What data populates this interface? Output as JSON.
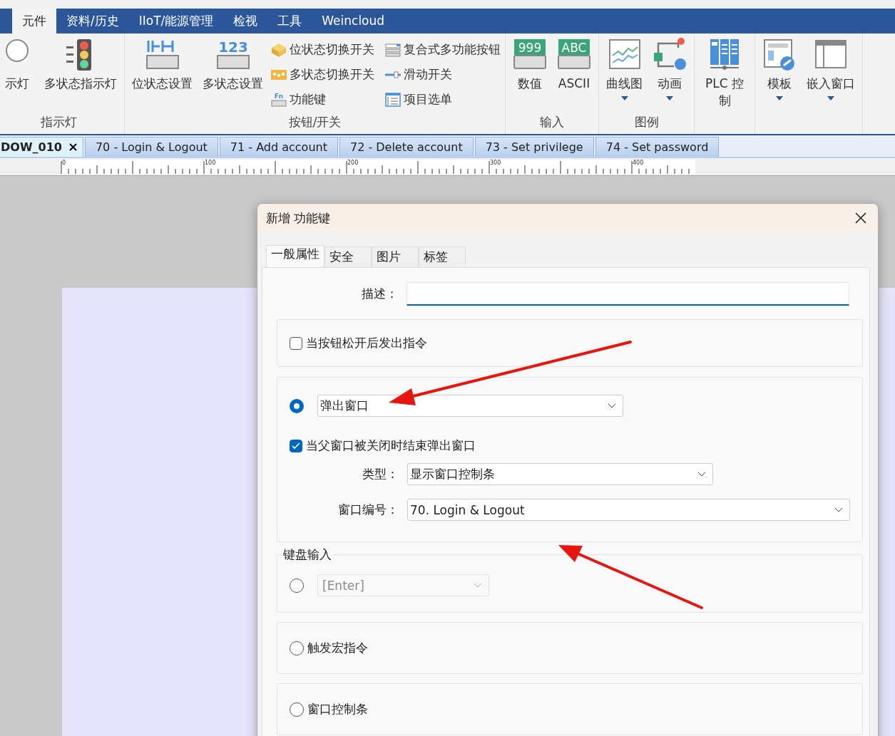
{
  "menu": [
    {
      "label": "元件",
      "selected": true
    },
    {
      "label": "资料/历史",
      "selected": false
    },
    {
      "label": "IIoT/能源管理",
      "selected": false
    },
    {
      "label": "检视",
      "selected": false
    },
    {
      "label": "工具",
      "selected": false
    },
    {
      "label": "Weincloud",
      "selected": false
    }
  ],
  "ribbon": [
    {
      "label": "指示灯",
      "large": [
        {
          "label": "示灯",
          "kind": "lamp"
        },
        {
          "label": "多状态指示灯",
          "kind": "traffic"
        }
      ]
    },
    {
      "label": "按钮/开关",
      "large": [
        {
          "label": "位状态设置",
          "kind": "bitset"
        },
        {
          "label": "多状态设置",
          "kind": "multiset",
          "icon_text": "123"
        }
      ],
      "small": [
        {
          "label": "位状态切换开关",
          "kind": "bittoggle"
        },
        {
          "label": "多状态切换开关",
          "kind": "multitoggle"
        },
        {
          "label": "功能键",
          "kind": "fn",
          "icon_text": "Fn"
        },
        {
          "label": "复合式多功能按钮",
          "kind": "combo"
        },
        {
          "label": "滑动开关",
          "kind": "slider"
        },
        {
          "label": "项目选单",
          "kind": "option"
        }
      ]
    },
    {
      "label": "输入",
      "large": [
        {
          "label": "数值",
          "kind": "numeric",
          "icon_text": "999"
        },
        {
          "label": "ASCII",
          "kind": "ascii",
          "icon_text": "ABC"
        }
      ]
    },
    {
      "label": "图例",
      "large": [
        {
          "label": "曲线图",
          "kind": "trend",
          "dropdown": true
        },
        {
          "label": "动画",
          "kind": "animation",
          "dropdown": true
        }
      ]
    },
    {
      "large": [
        {
          "label": "PLC 控制",
          "kind": "plc"
        }
      ]
    },
    {
      "large": [
        {
          "label": "模板",
          "kind": "template",
          "dropdown": true
        },
        {
          "label": "嵌入窗口",
          "kind": "embed",
          "dropdown": true
        }
      ]
    }
  ],
  "document_tabs": [
    {
      "label": "DOW_010",
      "selected": true
    },
    {
      "label": "70 - Login & Logout",
      "selected": false
    },
    {
      "label": "71 - Add account",
      "selected": false
    },
    {
      "label": "72 - Delete account",
      "selected": false
    },
    {
      "label": "73 - Set privilege",
      "selected": false
    },
    {
      "label": "74 - Set password",
      "selected": false
    }
  ],
  "ruler": [
    "0",
    "100",
    "200",
    "300",
    "400"
  ],
  "dialog": {
    "title": "新增 功能键",
    "tabs": [
      {
        "label": "一般属性",
        "selected": true
      },
      {
        "label": "安全",
        "selected": false
      },
      {
        "label": "图片",
        "selected": false
      },
      {
        "label": "标签",
        "selected": false
      }
    ],
    "description_label": "描述：",
    "release_option": {
      "label": "当按钮松开后发出指令",
      "checked": false
    },
    "modes": [
      {
        "kind": "popup",
        "selected": true,
        "value": "弹出窗口",
        "close_with_parent": {
          "label": "当父窗口被关闭时结束弹出窗口",
          "checked": true
        },
        "fields": [
          {
            "label": "类型：",
            "value": "显示窗口控制条"
          },
          {
            "label": "窗口编号：",
            "value": "70. Login & Logout"
          }
        ]
      },
      {
        "kind": "keyboard",
        "legend": "键盘输入",
        "selected": false,
        "value": "[Enter]",
        "disabled": true
      },
      {
        "kind": "plain",
        "selected": false,
        "label": "触发宏指令"
      },
      {
        "kind": "plain",
        "selected": false,
        "label": "窗口控制条"
      }
    ]
  }
}
